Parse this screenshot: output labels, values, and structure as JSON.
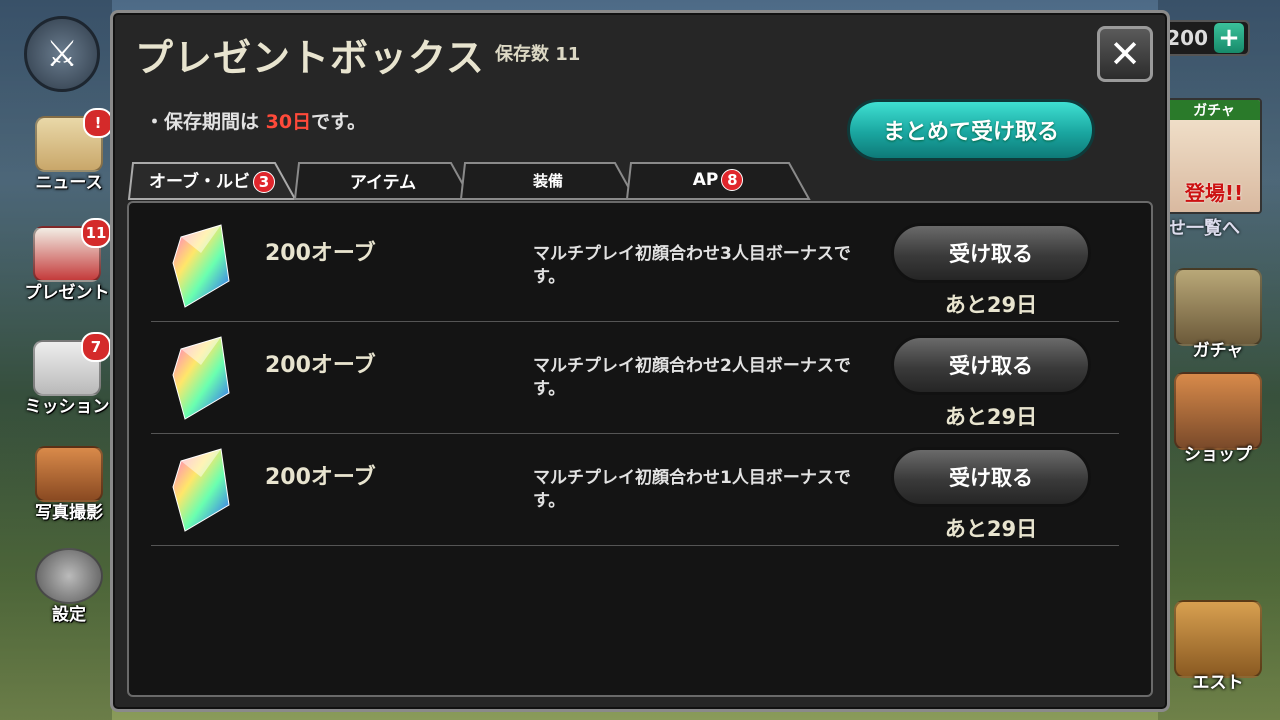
{
  "background": {
    "left_menu": [
      {
        "label": "ニュース",
        "badge": "!",
        "icon": "letter-icon"
      },
      {
        "label": "プレゼント",
        "badge": "11",
        "icon": "gift-icon"
      },
      {
        "label": "ミッション",
        "badge": "7",
        "icon": "quill-icon"
      },
      {
        "label": "写真撮影",
        "badge": "",
        "icon": "camera-icon"
      },
      {
        "label": "設定",
        "badge": "",
        "icon": "gear-icon"
      }
    ],
    "currency_value": "200",
    "plus_label": "+",
    "right_menu": [
      {
        "label": "ガチャ",
        "icon": "gacha-icon"
      },
      {
        "label": "ショップ",
        "icon": "shop-icon"
      },
      {
        "label": "エスト",
        "icon": "quest-map-icon"
      }
    ],
    "banner_top": "ガチャ",
    "banner_text": "登場!!",
    "banner_link": "せ一覧へ"
  },
  "modal": {
    "title": "プレゼントボックス",
    "count_label": "保存数 11",
    "close_label": "✕",
    "notice_prefix": "・保存期間は ",
    "notice_highlight": "30日",
    "notice_suffix": "です。",
    "bulk_button": "まとめて受け取る",
    "tabs": [
      {
        "label": "オーブ・ルビ",
        "badge": "3"
      },
      {
        "label": "アイテム",
        "badge": ""
      },
      {
        "label": "装備",
        "badge": ""
      },
      {
        "label": "AP",
        "badge": "8"
      }
    ],
    "items": [
      {
        "name": "200オーブ",
        "desc": "マルチプレイ初顔合わせ3人目ボーナスです。",
        "button": "受け取る",
        "remaining": "あと29日"
      },
      {
        "name": "200オーブ",
        "desc": "マルチプレイ初顔合わせ2人目ボーナスです。",
        "button": "受け取る",
        "remaining": "あと29日"
      },
      {
        "name": "200オーブ",
        "desc": "マルチプレイ初顔合わせ1人目ボーナスです。",
        "button": "受け取る",
        "remaining": "あと29日"
      }
    ]
  }
}
